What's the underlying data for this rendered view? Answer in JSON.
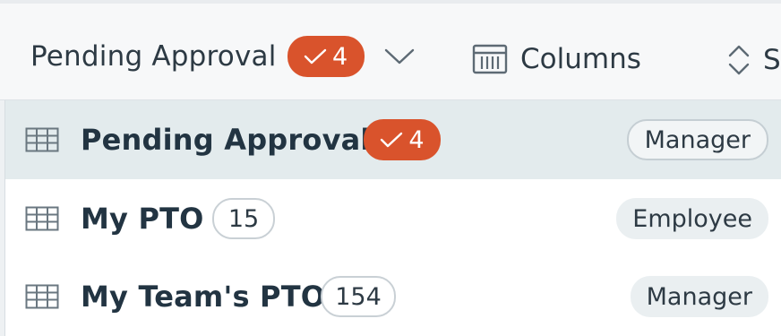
{
  "toolbar": {
    "view_label": "Pending Approval",
    "view_badge_count": "4",
    "columns_label": "Columns",
    "sort_label": "S"
  },
  "views": [
    {
      "label": "Pending Approval",
      "count": "4",
      "count_style": "approval",
      "role": "Manager",
      "selected": true
    },
    {
      "label": "My PTO",
      "count": "15",
      "count_style": "plain",
      "role": "Employee",
      "selected": false
    },
    {
      "label": "My Team's PTO",
      "count": "154",
      "count_style": "plain",
      "role": "Manager",
      "selected": false
    }
  ],
  "colors": {
    "accent_badge": "#d9532c",
    "selected_row": "#e3ebed",
    "text": "#223442"
  },
  "icons": {
    "check": "check-icon",
    "chevron": "chevron-down-icon",
    "columns": "columns-icon",
    "sort": "sort-icon",
    "table": "table-icon"
  }
}
